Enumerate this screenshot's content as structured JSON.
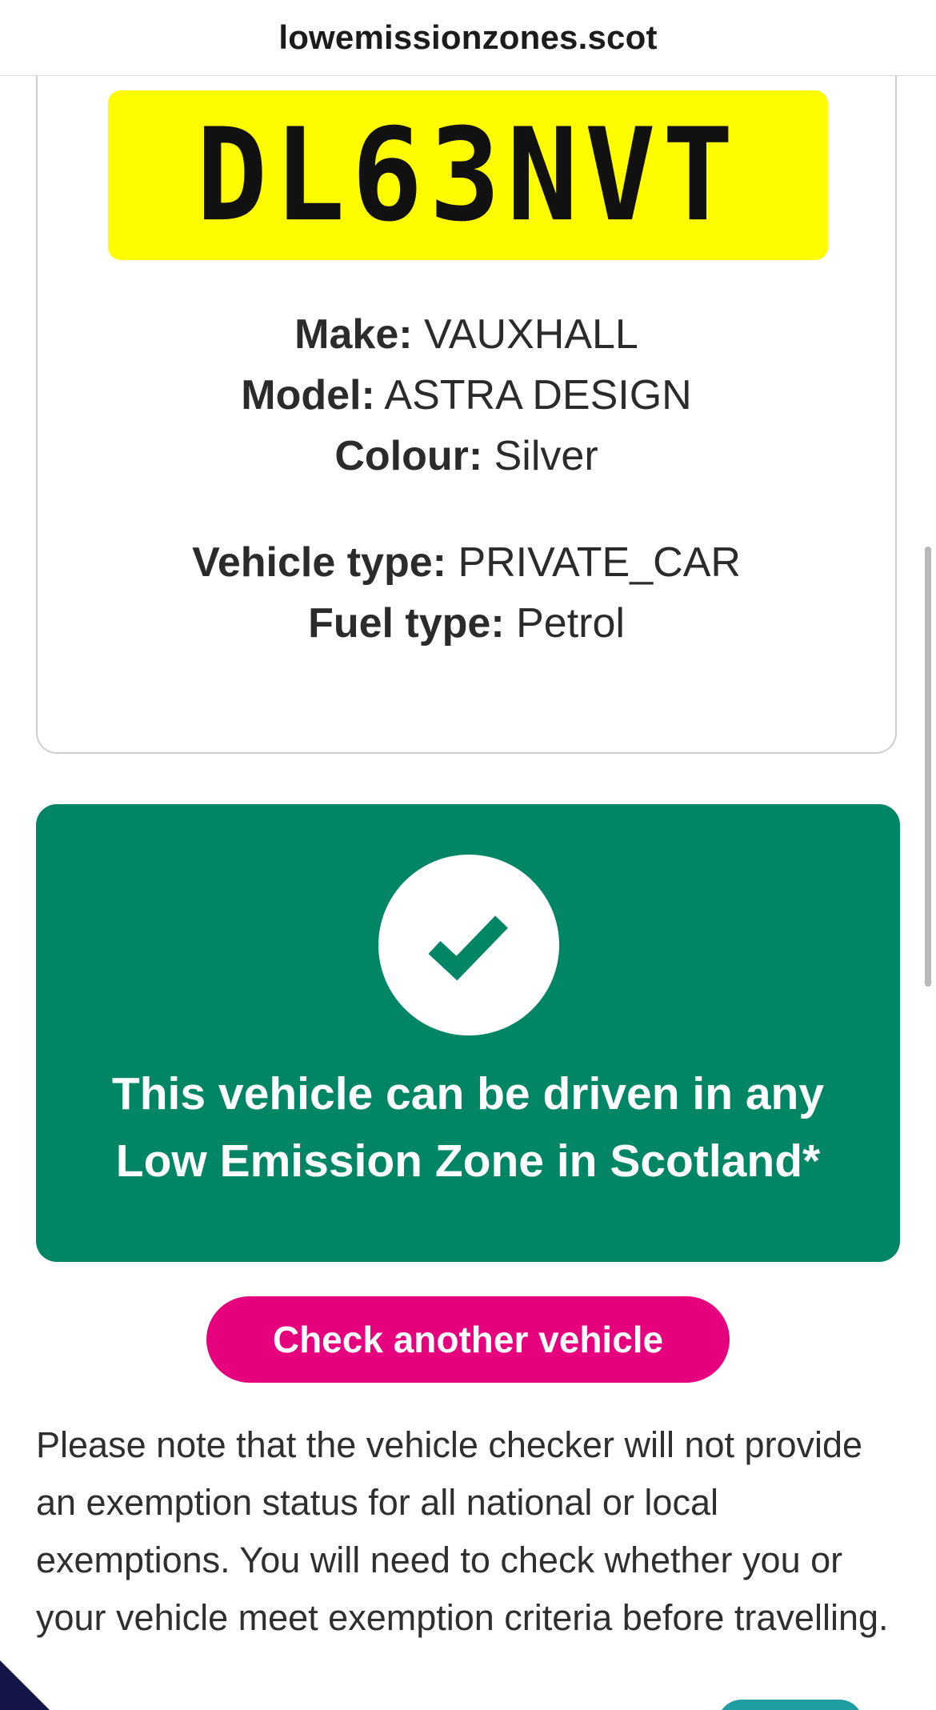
{
  "browser": {
    "url": "lowemissionzones.scot"
  },
  "vehicle": {
    "registration": "DL63NVT",
    "make_label": "Make:",
    "make": "VAUXHALL",
    "model_label": "Model:",
    "model": "ASTRA DESIGN",
    "colour_label": "Colour:",
    "colour": "Silver",
    "vehicle_type_label": "Vehicle type:",
    "vehicle_type": "PRIVATE_CAR",
    "fuel_type_label": "Fuel type:",
    "fuel_type": "Petrol"
  },
  "result": {
    "line1": "This vehicle can be driven in any",
    "line2": "Low Emission Zone in Scotland*",
    "icon": "checkmark-icon"
  },
  "actions": {
    "check_another": "Check another vehicle"
  },
  "note": {
    "text": "Please note that the vehicle checker will not provide an exemption status for all national or local exemptions. You will need to check whether you or your vehicle meet exemption criteria before travelling."
  },
  "colors": {
    "plate_yellow": "#fffc00",
    "result_green": "#008665",
    "button_pink": "#e6007e",
    "corner_navy": "#14164a",
    "tab_teal": "#1e9ea0"
  }
}
